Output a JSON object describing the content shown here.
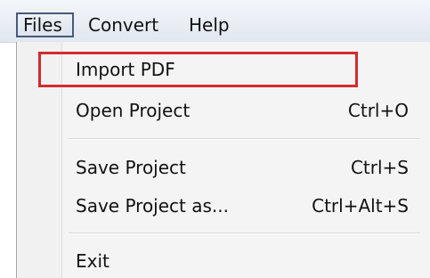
{
  "menubar": {
    "items": [
      {
        "label": "Files"
      },
      {
        "label": "Convert"
      },
      {
        "label": "Help"
      }
    ]
  },
  "files_menu": {
    "items": [
      {
        "label": "Import PDF",
        "shortcut": ""
      },
      {
        "label": "Open Project",
        "shortcut": "Ctrl+O"
      },
      {
        "label": "Save Project",
        "shortcut": "Ctrl+S"
      },
      {
        "label": "Save Project as...",
        "shortcut": "Ctrl+Alt+S"
      },
      {
        "label": "Exit",
        "shortcut": ""
      }
    ]
  },
  "colors": {
    "highlight_box": "#d42a2f",
    "active_menu_border": "#48597a"
  }
}
